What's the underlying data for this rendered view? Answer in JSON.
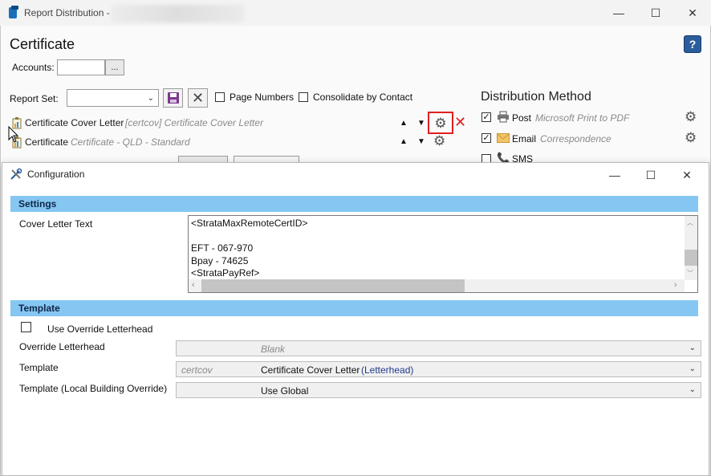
{
  "window": {
    "title": "Report Distribution -",
    "controls": {
      "minimize": "—",
      "maximize": "☐",
      "close": "✕"
    }
  },
  "header": {
    "heading": "Certificate"
  },
  "accounts": {
    "label": "Accounts:",
    "value": "",
    "browse_label": "..."
  },
  "report_set": {
    "label": "Report Set:",
    "selected": "",
    "page_numbers_label": "Page Numbers",
    "page_numbers_checked": false,
    "consolidate_label": "Consolidate by Contact",
    "consolidate_checked": false
  },
  "reports": [
    {
      "name": "Certificate Cover Letter",
      "code": "[certcov] Certificate Cover Letter"
    },
    {
      "name": "Certificate",
      "code": "Certificate - QLD - Standard"
    }
  ],
  "distribution": {
    "title": "Distribution Method",
    "methods": [
      {
        "name": "Post",
        "detail": "Microsoft Print to PDF",
        "checked": true,
        "icon": "printer-icon"
      },
      {
        "name": "Email",
        "detail": "Correspondence",
        "checked": true,
        "icon": "envelope-icon"
      },
      {
        "name": "SMS",
        "detail": "",
        "checked": false,
        "icon": "phone-icon"
      }
    ]
  },
  "config_dialog": {
    "title": "Configuration",
    "controls": {
      "minimize": "—",
      "maximize": "☐",
      "close": "✕"
    },
    "settings_header": "Settings",
    "cover_letter_label": "Cover Letter Text",
    "cover_letter_lines": [
      "<StrataMaxRemoteCertID>",
      "",
      "EFT - 067-970",
      "Bpay - 74625",
      "<StrataPayRef>"
    ],
    "template_header": "Template",
    "use_override_label": "Use Override Letterhead",
    "use_override_checked": false,
    "override_letterhead_label": "Override Letterhead",
    "override_letterhead_value": "Blank",
    "template_label": "Template",
    "template_code": "certcov",
    "template_value": "Certificate Cover Letter",
    "template_suffix": "(Letterhead)",
    "local_override_label": "Template (Local Building Override)",
    "local_override_value": "Use Global"
  },
  "colors": {
    "section_bg": "#85c7f2",
    "highlight_red": "#e02020",
    "link_blue": "#1f3a8a"
  }
}
